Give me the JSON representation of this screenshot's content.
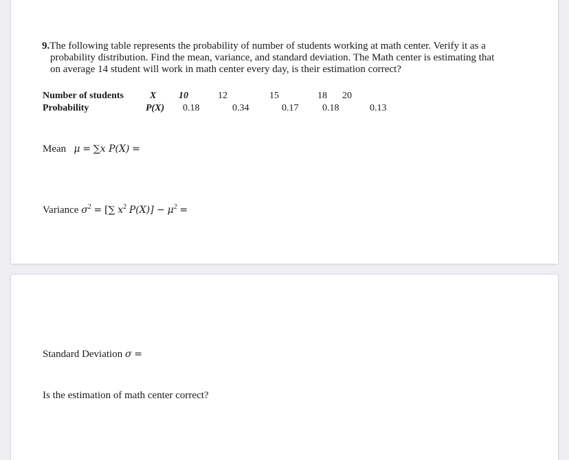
{
  "question": {
    "number": "9.",
    "lines": [
      "The following table represents the probability of number of students working at math center. Verify it as a",
      "probability distribution. Find the mean, variance, and standard deviation. The Math center is estimating that",
      "on average 14 student will work in math center every day, is their estimation correct?"
    ]
  },
  "table": {
    "row1_label": "Number of students",
    "row1_symbol": "X",
    "row2_label": "Probability",
    "row2_symbol": "P(X)",
    "x_values": [
      "10",
      "12",
      "15",
      "18",
      "20"
    ],
    "p_values": [
      "0.18",
      "0.34",
      "0.17",
      "0.18",
      "0.13"
    ]
  },
  "mean": {
    "label": "Mean",
    "symbol": "μ",
    "eq": "=",
    "sum": "∑",
    "expr": "x P(X)",
    "tail": "="
  },
  "variance": {
    "label": "Variance",
    "symbol": "σ",
    "sq": "2",
    "eq": "=",
    "open": "[∑",
    "x": "x",
    "mid": "P(X)] −",
    "mu": "μ",
    "tail": "="
  },
  "std_dev": {
    "label": "Standard Deviation",
    "symbol": "σ",
    "tail": "="
  },
  "estimation_question": "Is the estimation of math center correct?"
}
